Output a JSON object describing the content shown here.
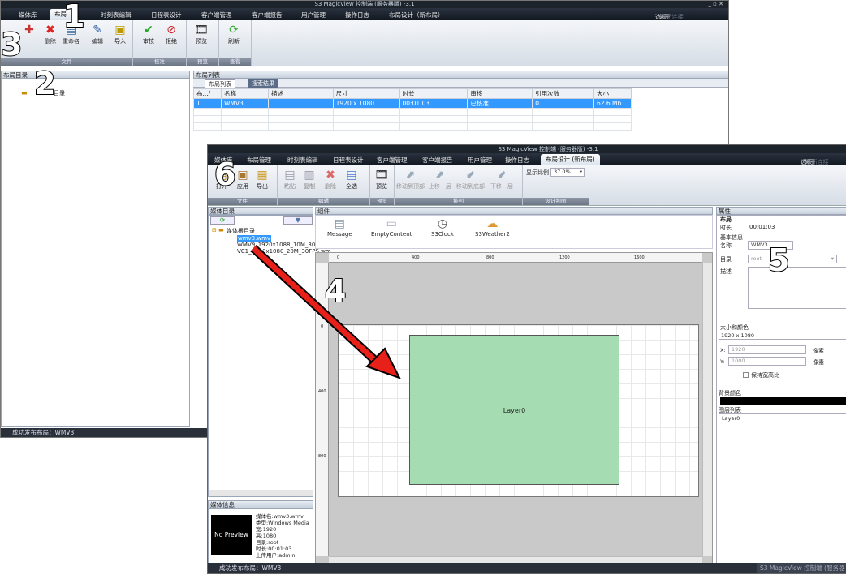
{
  "back": {
    "title": "S3 MagicView 控制端 (服务器版) -3.1",
    "menu": [
      "媒体库",
      "布局",
      "时刻表编辑",
      "日程表设计",
      "客户端管理",
      "客户端报告",
      "用户管理",
      "操作日志",
      "布局设计（新布局）"
    ],
    "right_menu": [
      "选项",
      "关于",
      "重新连接"
    ],
    "ribbon": {
      "buttons": [
        "新建",
        "删除",
        "重命名",
        "编辑",
        "导入",
        "审核",
        "拒绝",
        "预览",
        "刷新"
      ],
      "groups": [
        "文件",
        "核准",
        "预览",
        "查看"
      ]
    },
    "left_header": "布局目录",
    "tree_item": "目录",
    "list_header": "布局列表",
    "tabs": [
      "布局列表",
      "搜索结果"
    ],
    "columns": [
      "布.../",
      "名称",
      "描述",
      "尺寸",
      "时长",
      "审核",
      "引用次数",
      "大小"
    ],
    "rows": [
      [
        "1",
        "WMV3",
        "",
        "1920 x 1080",
        "00:01:03",
        "已核准",
        "0",
        "62.6 Mb"
      ]
    ],
    "status": "成功发布布局：WMV3"
  },
  "front": {
    "title": "S3 MagicView 控制端 (服务器版) -3.1",
    "menu": [
      "媒体库",
      "布局管理",
      "时刻表编辑",
      "日程表设计",
      "客户端管理",
      "客户端报告",
      "用户管理",
      "操作日志",
      "布局设计 (新布局)"
    ],
    "right_menu": [
      "选项",
      "关于",
      "重新连接"
    ],
    "ribbon": {
      "buttons": [
        "打开",
        "应用",
        "导出",
        "粘贴",
        "复制",
        "删除",
        "全选",
        "预览",
        "移动到顶部",
        "上移一层",
        "移动到底部",
        "下移一层"
      ],
      "zoom_label": "显示比例",
      "zoom_value": "37.0%",
      "groups": [
        "文件",
        "编辑",
        "预览",
        "排列",
        "设计视图"
      ]
    },
    "media_header": "媒体目录",
    "media_tree": {
      "root": "媒体根目录",
      "items": [
        "wmv3.wmv",
        "WMV9_1920x1088_10M_30FPS",
        "VC1_1920x1080_20M_30FPS.wm"
      ]
    },
    "media_info_header": "媒体信息",
    "preview_text": "No Preview",
    "media_info": [
      "媒体名:wmv3.wmv",
      "类型:Windows Media",
      "宽:1920",
      "高:1080",
      "目录:root",
      "时长:00:01:03",
      "上传用户:admin"
    ],
    "components_header": "组件",
    "components": [
      "Message",
      "EmptyContent",
      "S3Clock",
      "S3Weather2"
    ],
    "ruler_top": [
      "0",
      "400",
      "800",
      "1200",
      "1600"
    ],
    "ruler_left": [
      "0",
      "400",
      "800"
    ],
    "layer_label": "Layer0",
    "props": {
      "header": "属性",
      "section": "布局",
      "duration_label": "时长",
      "duration": "00:01:03",
      "basic": "基本信息",
      "name_label": "名称",
      "name": "WMV3",
      "dir_label": "目录",
      "dir": "root",
      "desc_label": "描述",
      "size_color": "大小和颜色",
      "size": "1920 x 1080",
      "x_label": "X:",
      "x_val": "1920",
      "y_label": "Y:",
      "y_val": "1000",
      "unit": "像素",
      "keep": "保持宽高比",
      "bg_label": "背景颜色",
      "layers_label": "图层列表",
      "layer": "Layer0",
      "bg_color": "#000000"
    },
    "status": "成功发布布局：WMV3",
    "status_right": "S3 MagicView 控制端 (服务器版)"
  },
  "callouts": [
    "1",
    "2",
    "3",
    "4",
    "5",
    "6"
  ],
  "colors": {
    "layer_fill": "#a5dcb1",
    "selection": "#3399ff",
    "arrow": "#e8201a"
  }
}
